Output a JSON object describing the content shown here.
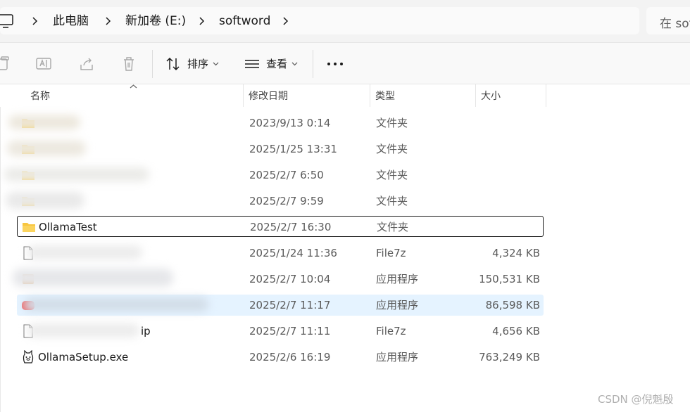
{
  "breadcrumb": {
    "items": [
      "此电脑",
      "新加卷 (E:)",
      "softword"
    ]
  },
  "search": {
    "placeholder": "在 sof"
  },
  "toolbar": {
    "sort_label": "排序",
    "view_label": "查看"
  },
  "columns": {
    "name": "名称",
    "date": "修改日期",
    "type": "类型",
    "size": "大小"
  },
  "files": [
    {
      "name": "",
      "date": "2023/9/13 0:14",
      "type": "文件夹",
      "size": "",
      "icon": "folder-icon"
    },
    {
      "name": "",
      "date": "2025/1/25 13:31",
      "type": "文件夹",
      "size": "",
      "icon": "folder-icon"
    },
    {
      "name": "",
      "date": "2025/2/7 6:50",
      "type": "文件夹",
      "size": "",
      "icon": "folder-icon"
    },
    {
      "name": "",
      "date": "2025/2/7 9:59",
      "type": "文件夹",
      "size": "",
      "icon": "folder-icon"
    },
    {
      "name": "OllamaTest",
      "date": "2025/2/7 16:30",
      "type": "文件夹",
      "size": "",
      "icon": "folder-icon"
    },
    {
      "name": "",
      "date": "2025/1/24 11:36",
      "type": "File7z",
      "size": "4,324 KB",
      "icon": "file-icon"
    },
    {
      "name": "",
      "date": "2025/2/7 10:04",
      "type": "应用程序",
      "size": "150,531 KB",
      "icon": "app-icon"
    },
    {
      "name": "",
      "date": "2025/2/7 11:17",
      "type": "应用程序",
      "size": "86,598 KB",
      "icon": "app-icon"
    },
    {
      "name": "ip",
      "date": "2025/2/7 11:11",
      "type": "File7z",
      "size": "4,656 KB",
      "icon": "file-icon"
    },
    {
      "name": "OllamaSetup.exe",
      "date": "2025/2/6 16:19",
      "type": "应用程序",
      "size": "763,249 KB",
      "icon": "ollama-icon"
    }
  ],
  "watermark": "CSDN @倪魁殷"
}
